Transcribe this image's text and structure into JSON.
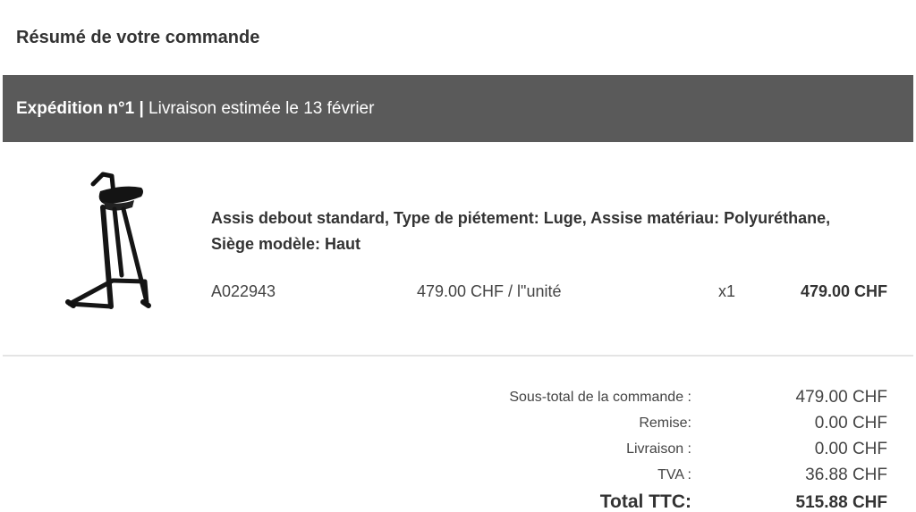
{
  "order": {
    "title": "Résumé de votre commande"
  },
  "shipment": {
    "number_label": "Expédition n°1",
    "separator": " | ",
    "delivery_estimate": "Livraison estimée le 13 février"
  },
  "item": {
    "image_icon": "standing-stool-icon",
    "description": "Assis debout standard, Type de piétement: Luge, Assise matériau: Polyuréthane, Siège modèle: Haut",
    "sku": "A022943",
    "unit_price": "479.00 CHF / l\"unité",
    "quantity": "x1",
    "line_total": "479.00 CHF"
  },
  "totals": {
    "subtotal_label": "Sous-total de la commande :",
    "subtotal_value": "479.00 CHF",
    "discount_label": "Remise:",
    "discount_value": "0.00 CHF",
    "shipping_label": "Livraison :",
    "shipping_value": "0.00 CHF",
    "vat_label": "TVA :",
    "vat_value": "36.88 CHF",
    "total_label": "Total TTC:",
    "total_value": "515.88 CHF"
  },
  "colors": {
    "shipment_bar": "#5a5a5a",
    "text": "#333333"
  }
}
